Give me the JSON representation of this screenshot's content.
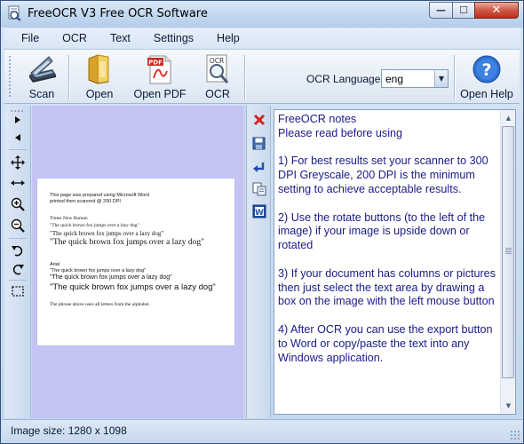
{
  "window": {
    "title": "FreeOCR V3 Free OCR Software",
    "minimize_glyph": "—",
    "maximize_glyph": "☐",
    "close_glyph": "✕"
  },
  "menu": {
    "items": [
      "File",
      "OCR",
      "Text",
      "Settings",
      "Help"
    ]
  },
  "toolbar": {
    "scan_label": "Scan",
    "open_label": "Open",
    "open_pdf_label": "Open PDF",
    "ocr_label": "OCR",
    "ocr_language_label": "OCR Language:",
    "ocr_language_value": "eng",
    "open_help_label": "Open Help",
    "pdf_badge": "PDF",
    "ocr_badge": "OCR"
  },
  "left_tools": {
    "icons": [
      "next-page-icon",
      "prev-page-icon",
      "move-icon",
      "fit-width-icon",
      "zoom-in-icon",
      "zoom-out-icon",
      "rotate-left-icon",
      "rotate-right-icon",
      "select-area-icon"
    ]
  },
  "right_tools": {
    "icons": [
      "clear-icon",
      "save-icon",
      "insert-icon",
      "copy-icon",
      "word-export-icon"
    ],
    "word_badge": "W"
  },
  "preview": {
    "background": "#c4c4f4",
    "page_lines": [
      "This page was prepared using Microsoft Word",
      "printed then scanned @ 200 DPI",
      "Times New Roman",
      "\"The quick brown fox jumps over a lazy dog\"",
      "\"The quick brown fox jumps over a lazy dog\"",
      "\"The quick brown fox jumps over a lazy dog\"",
      "Arial",
      "\"The quick brown fox jumps over a lazy dog\"",
      "\"The quick brown fox jumps over a lazy dog\"",
      "\"The quick brown fox jumps over a lazy dog\"",
      "The phrase above uses all letters from the alphabet."
    ]
  },
  "notes": {
    "text": "FreeOCR notes\nPlease read before using\n\n1) For best results set your scanner to 300 DPI Greyscale, 200 DPI is the minimum setting to achieve acceptable results.\n\n2) Use the rotate buttons (to the left of the image) if your image is upside down or rotated\n\n3) If your document has columns or pictures then just select the text area by drawing a box on the image with the left mouse button\n\n4) After OCR you can use the export button to Word or copy/paste the text into any Windows application."
  },
  "status": {
    "image_size": "Image size:  1280 x 1098"
  },
  "colors": {
    "text_blue": "#1a1a8a",
    "chrome": "#c2d6ef",
    "close_red": "#cf5a45"
  }
}
